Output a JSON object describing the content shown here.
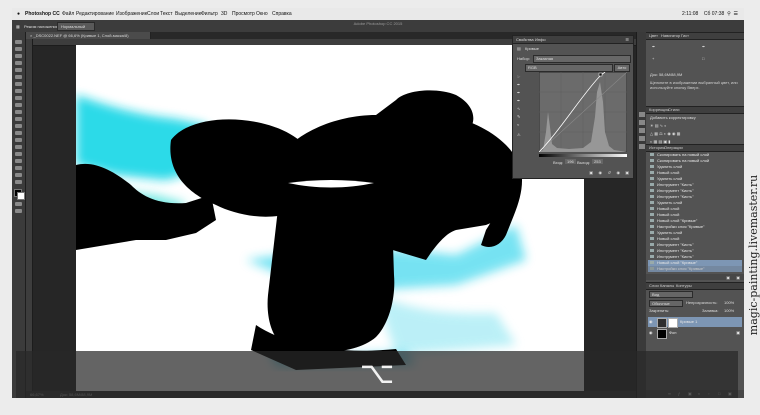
{
  "menubar": {
    "apple_icon": "apple-icon",
    "items": [
      "Photoshop CC",
      "Файл",
      "Редактирование",
      "Изображение",
      "Слои",
      "Текст",
      "Выделение",
      "Фильтр",
      "3D",
      "Просмотр",
      "Окно",
      "Справка"
    ],
    "status_time_left": "2:11:08",
    "status_day_time": "Сб 07:38"
  },
  "window": {
    "title": "Adobe Photoshop CC 2015"
  },
  "options": {
    "label": "Режим наложения",
    "mode_value": "Нормальный"
  },
  "document": {
    "tab_label": "_DSC0022.NEF @ 66,6% (Кривые 1, Слой-маска/8)",
    "zoom": "66,67%",
    "doc_size": "Док: 58,6M/88,9M"
  },
  "properties_panel": {
    "tabs": [
      "Свойства",
      "Инфо"
    ],
    "title": "Кривые",
    "preset_label": "Набор:",
    "preset_value": "Заказная",
    "channel_value": "RGB",
    "auto_label": "Авто",
    "input_label": "Вход:",
    "input_value": "196",
    "output_label": "Выход:",
    "output_value": "253"
  },
  "navigator_panel": {
    "tabs": [
      "Цвет",
      "Навигатор",
      "Гист"
    ],
    "doc_info": "Док: 58,6М/88,9М",
    "hint": "Щелкните в изображении выбранный цвет, или используйте кнопку Вверх."
  },
  "adjustments_panel": {
    "tabs": [
      "Коррекция",
      "Стили"
    ],
    "title": "Добавить корректировку"
  },
  "history_panel": {
    "tabs": [
      "История",
      "Операции"
    ],
    "items": [
      "Скопировать на новый слой",
      "Скопировать на новый слой",
      "Удалить слой",
      "Новый слой",
      "Удалить слой",
      "Инструмент \"Кисть\"",
      "Инструмент \"Кисть\"",
      "Инструмент \"Кисть\"",
      "Удалить слой",
      "Новый слой",
      "Новый слой",
      "Новый слой \"Кривые\"",
      "Настройки слоя \"Кривые\"",
      "Удалить слой",
      "Новый слой",
      "Инструмент \"Кисть\"",
      "Инструмент \"Кисть\"",
      "Инструмент \"Кисть\"",
      "Новый слой \"Кривые\"",
      "Настройки слоя \"Кривые\""
    ],
    "selected_index": 18
  },
  "layers_panel": {
    "tabs": [
      "Слои",
      "Каналы",
      "Контуры"
    ],
    "kind_label": "Вид",
    "blend_mode": "Обычные",
    "opacity_label": "Непрозрачность:",
    "opacity_value": "100%",
    "lock_label": "Закрепить:",
    "fill_label": "Заливка:",
    "fill_value": "100%",
    "layers": [
      {
        "name": "Кривые 1",
        "kind": "adjustment"
      },
      {
        "name": "Фон",
        "kind": "background"
      }
    ]
  },
  "overlay": {
    "key_symbol": "⌥"
  },
  "watermark": {
    "text": "magic-painting.livemaster.ru"
  },
  "colors": {
    "accent": "#7d96b4",
    "panel": "#535353",
    "canvas": "#ffffff"
  }
}
